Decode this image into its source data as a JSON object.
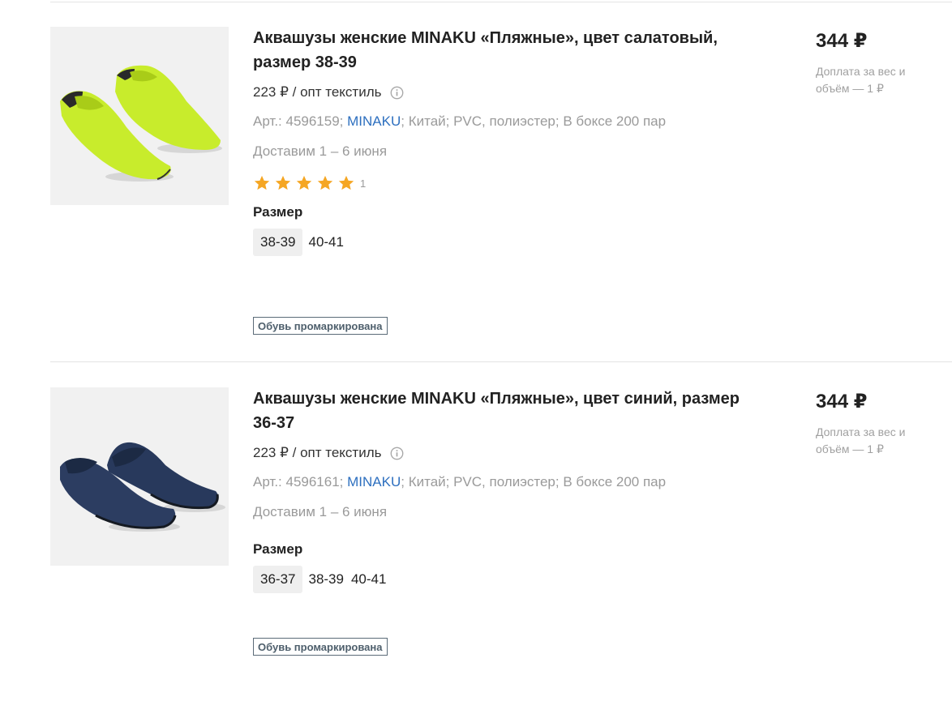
{
  "products": [
    {
      "title": "Аквашузы женские MINAKU «Пляжные», цвет салатовый, размер 38-39",
      "image_alt": "lime-green water shoes",
      "image_color": "#c6ea2a",
      "unit_price": "223 ₽ / опт текстиль",
      "details_prefix": "Арт.: 4596159; ",
      "brand": "MINAKU",
      "details_suffix": "; Китай; PVC, полиэстер; В боксе 200 пар",
      "delivery": "Доставим 1 – 6 июня",
      "rating": 5,
      "review_count": "1",
      "size_label": "Размер",
      "sizes": [
        "38-39",
        "40-41"
      ],
      "selected_size": "38-39",
      "marked_label": "Обувь промаркирована",
      "price": "344 ₽",
      "surcharge": "Доплата за вес и объём — 1 ₽"
    },
    {
      "title": "Аквашузы женские MINAKU «Пляжные», цвет синий, размер 36-37",
      "image_alt": "navy blue water shoes",
      "image_color": "#27385a",
      "unit_price": "223 ₽ / опт текстиль",
      "details_prefix": "Арт.: 4596161; ",
      "brand": "MINAKU",
      "details_suffix": "; Китай; PVC, полиэстер; В боксе 200 пар",
      "delivery": "Доставим 1 – 6 июня",
      "rating": null,
      "review_count": "",
      "size_label": "Размер",
      "sizes": [
        "36-37",
        "38-39",
        "40-41"
      ],
      "selected_size": "36-37",
      "marked_label": "Обувь промаркирована",
      "price": "344 ₽",
      "surcharge": "Доплата за вес и объём — 1 ₽"
    }
  ],
  "colors": {
    "brand_link": "#2d6fbf",
    "star": "#f5a623",
    "muted_text": "#9a9a9a",
    "divider": "#e4e4e4"
  },
  "icons": {
    "info": "info-circle-icon",
    "star": "star-icon"
  }
}
